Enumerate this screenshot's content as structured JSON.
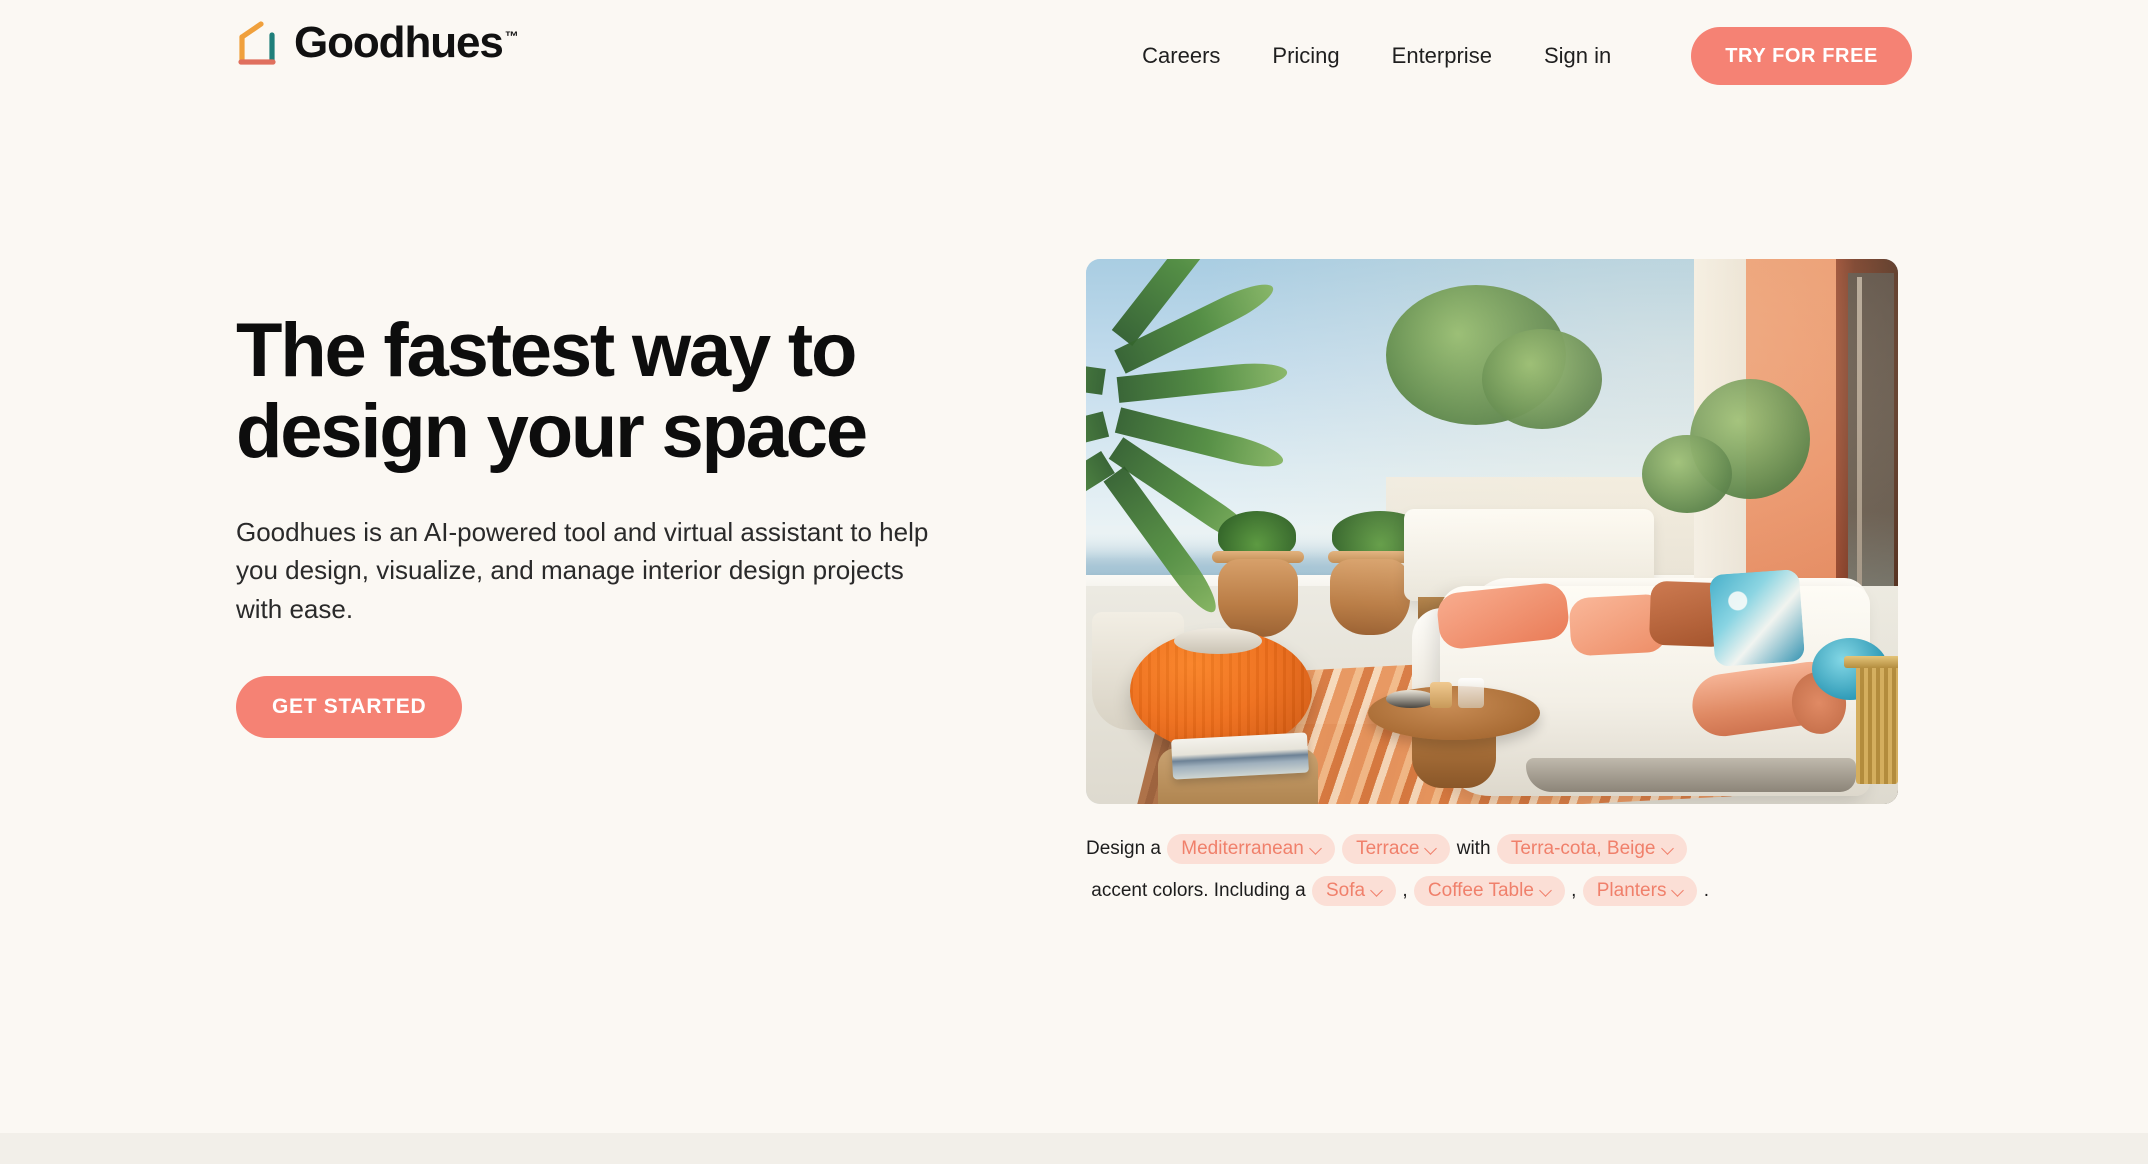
{
  "brand": {
    "name": "Goodhues",
    "trademark": "™",
    "logo_icon": "house-outline-icon",
    "logo_colors": {
      "roof": "#f0a03c",
      "left": "#f0a03c",
      "right": "#1f7f7a",
      "bottom": "#e0705e"
    }
  },
  "nav": {
    "items": [
      {
        "label": "Careers",
        "name": "nav-link-careers"
      },
      {
        "label": "Pricing",
        "name": "nav-link-pricing"
      },
      {
        "label": "Enterprise",
        "name": "nav-link-enterprise"
      },
      {
        "label": "Sign in",
        "name": "nav-link-sign-in"
      }
    ],
    "cta_label": "TRY FOR FREE"
  },
  "hero": {
    "title_line1": "The fastest way to",
    "title_line2": "design your space",
    "subtitle": "Goodhues is an AI-powered tool and virtual assistant to help you design, visualize, and manage interior design projects with ease.",
    "cta_label": "GET STARTED",
    "image_alt": "Mediterranean terrace with white sofa, orange ottoman, wood coffee table, potted plants and ocean view"
  },
  "prompt": {
    "seg1": "Design a ",
    "token_style": "Mediterranean",
    "seg2": " ",
    "token_room": "Terrace",
    "seg3": " with ",
    "token_colors": "Terra-cota, Beige",
    "seg4": " accent colors. Including a ",
    "token_item1": "Sofa",
    "seg5": " , ",
    "token_item2": "Coffee Table",
    "seg6": " , ",
    "token_item3": "Planters",
    "seg7": " ."
  },
  "colors": {
    "page_background": "#fbf8f3",
    "accent": "#f58274",
    "token_background": "#fbdfd6",
    "token_text": "#f0806b",
    "footer_band": "#f2efe9",
    "heading": "#0d0d0d"
  }
}
